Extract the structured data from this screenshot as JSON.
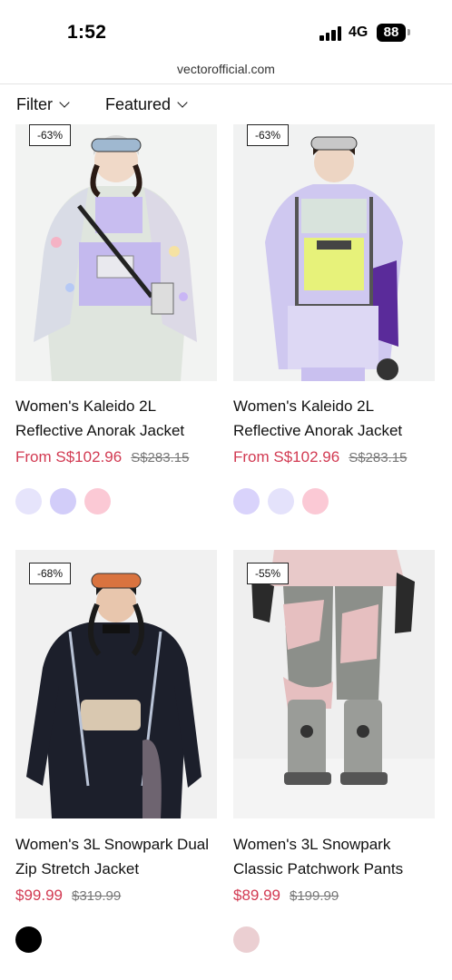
{
  "status_bar": {
    "time": "1:52",
    "network": "4G",
    "battery": "88"
  },
  "browser": {
    "url": "vectorofficial.com"
  },
  "toolbar": {
    "filter_label": "Filter",
    "sort_label": "Featured"
  },
  "products": [
    {
      "badge": "-63%",
      "title_line1": "Women's Kaleido 2L",
      "title_line2": "Reflective Anorak Jacket",
      "price": "From S$102.96",
      "old_price": "S$283.15",
      "swatches": [
        "#e6e4fb",
        "#d2cdf9",
        "#fbc9d5"
      ]
    },
    {
      "badge": "-63%",
      "title_line1": "Women's Kaleido 2L",
      "title_line2": "Reflective Anorak Jacket",
      "price": "From S$102.96",
      "old_price": "S$283.15",
      "swatches": [
        "#d9d3fb",
        "#e4e2fb",
        "#fbc9d5"
      ]
    },
    {
      "badge": "-68%",
      "title_line1": "Women's 3L Snowpark Dual",
      "title_line2": "Zip Stretch Jacket",
      "price": "$99.99",
      "old_price": "$319.99",
      "swatches": [
        "#000000"
      ]
    },
    {
      "badge": "-55%",
      "title_line1": "Women's 3L Snowpark",
      "title_line2": "Classic Patchwork Pants",
      "price": "$89.99",
      "old_price": "$199.99",
      "swatches": [
        "#ebcfd2"
      ]
    }
  ],
  "colors": {
    "price_accent": "#d23a52",
    "strike": "#777777"
  }
}
